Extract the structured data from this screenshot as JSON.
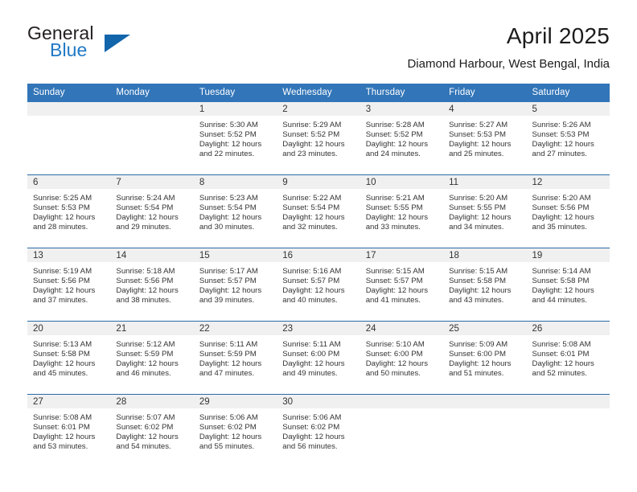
{
  "brand": {
    "name_top": "General",
    "name_bottom": "Blue",
    "triangle_color": "#1265ab",
    "text_color": "#231f20",
    "blue_color": "#2079c6"
  },
  "header": {
    "title": "April 2025",
    "subtitle": "Diamond Harbour, West Bengal, India"
  },
  "theme": {
    "header_row_bg": "#3275b8",
    "header_row_text": "#ffffff",
    "row_separator": "#2a6aa8",
    "daynum_band_bg": "#f0f0f0",
    "body_text": "#333333"
  },
  "weekdays": [
    "Sunday",
    "Monday",
    "Tuesday",
    "Wednesday",
    "Thursday",
    "Friday",
    "Saturday"
  ],
  "weeks": [
    [
      {
        "day": "",
        "lines": [
          "",
          "",
          "",
          ""
        ]
      },
      {
        "day": "",
        "lines": [
          "",
          "",
          "",
          ""
        ]
      },
      {
        "day": "1",
        "lines": [
          "Sunrise: 5:30 AM",
          "Sunset: 5:52 PM",
          "Daylight: 12 hours",
          "and 22 minutes."
        ]
      },
      {
        "day": "2",
        "lines": [
          "Sunrise: 5:29 AM",
          "Sunset: 5:52 PM",
          "Daylight: 12 hours",
          "and 23 minutes."
        ]
      },
      {
        "day": "3",
        "lines": [
          "Sunrise: 5:28 AM",
          "Sunset: 5:52 PM",
          "Daylight: 12 hours",
          "and 24 minutes."
        ]
      },
      {
        "day": "4",
        "lines": [
          "Sunrise: 5:27 AM",
          "Sunset: 5:53 PM",
          "Daylight: 12 hours",
          "and 25 minutes."
        ]
      },
      {
        "day": "5",
        "lines": [
          "Sunrise: 5:26 AM",
          "Sunset: 5:53 PM",
          "Daylight: 12 hours",
          "and 27 minutes."
        ]
      }
    ],
    [
      {
        "day": "6",
        "lines": [
          "Sunrise: 5:25 AM",
          "Sunset: 5:53 PM",
          "Daylight: 12 hours",
          "and 28 minutes."
        ]
      },
      {
        "day": "7",
        "lines": [
          "Sunrise: 5:24 AM",
          "Sunset: 5:54 PM",
          "Daylight: 12 hours",
          "and 29 minutes."
        ]
      },
      {
        "day": "8",
        "lines": [
          "Sunrise: 5:23 AM",
          "Sunset: 5:54 PM",
          "Daylight: 12 hours",
          "and 30 minutes."
        ]
      },
      {
        "day": "9",
        "lines": [
          "Sunrise: 5:22 AM",
          "Sunset: 5:54 PM",
          "Daylight: 12 hours",
          "and 32 minutes."
        ]
      },
      {
        "day": "10",
        "lines": [
          "Sunrise: 5:21 AM",
          "Sunset: 5:55 PM",
          "Daylight: 12 hours",
          "and 33 minutes."
        ]
      },
      {
        "day": "11",
        "lines": [
          "Sunrise: 5:20 AM",
          "Sunset: 5:55 PM",
          "Daylight: 12 hours",
          "and 34 minutes."
        ]
      },
      {
        "day": "12",
        "lines": [
          "Sunrise: 5:20 AM",
          "Sunset: 5:56 PM",
          "Daylight: 12 hours",
          "and 35 minutes."
        ]
      }
    ],
    [
      {
        "day": "13",
        "lines": [
          "Sunrise: 5:19 AM",
          "Sunset: 5:56 PM",
          "Daylight: 12 hours",
          "and 37 minutes."
        ]
      },
      {
        "day": "14",
        "lines": [
          "Sunrise: 5:18 AM",
          "Sunset: 5:56 PM",
          "Daylight: 12 hours",
          "and 38 minutes."
        ]
      },
      {
        "day": "15",
        "lines": [
          "Sunrise: 5:17 AM",
          "Sunset: 5:57 PM",
          "Daylight: 12 hours",
          "and 39 minutes."
        ]
      },
      {
        "day": "16",
        "lines": [
          "Sunrise: 5:16 AM",
          "Sunset: 5:57 PM",
          "Daylight: 12 hours",
          "and 40 minutes."
        ]
      },
      {
        "day": "17",
        "lines": [
          "Sunrise: 5:15 AM",
          "Sunset: 5:57 PM",
          "Daylight: 12 hours",
          "and 41 minutes."
        ]
      },
      {
        "day": "18",
        "lines": [
          "Sunrise: 5:15 AM",
          "Sunset: 5:58 PM",
          "Daylight: 12 hours",
          "and 43 minutes."
        ]
      },
      {
        "day": "19",
        "lines": [
          "Sunrise: 5:14 AM",
          "Sunset: 5:58 PM",
          "Daylight: 12 hours",
          "and 44 minutes."
        ]
      }
    ],
    [
      {
        "day": "20",
        "lines": [
          "Sunrise: 5:13 AM",
          "Sunset: 5:58 PM",
          "Daylight: 12 hours",
          "and 45 minutes."
        ]
      },
      {
        "day": "21",
        "lines": [
          "Sunrise: 5:12 AM",
          "Sunset: 5:59 PM",
          "Daylight: 12 hours",
          "and 46 minutes."
        ]
      },
      {
        "day": "22",
        "lines": [
          "Sunrise: 5:11 AM",
          "Sunset: 5:59 PM",
          "Daylight: 12 hours",
          "and 47 minutes."
        ]
      },
      {
        "day": "23",
        "lines": [
          "Sunrise: 5:11 AM",
          "Sunset: 6:00 PM",
          "Daylight: 12 hours",
          "and 49 minutes."
        ]
      },
      {
        "day": "24",
        "lines": [
          "Sunrise: 5:10 AM",
          "Sunset: 6:00 PM",
          "Daylight: 12 hours",
          "and 50 minutes."
        ]
      },
      {
        "day": "25",
        "lines": [
          "Sunrise: 5:09 AM",
          "Sunset: 6:00 PM",
          "Daylight: 12 hours",
          "and 51 minutes."
        ]
      },
      {
        "day": "26",
        "lines": [
          "Sunrise: 5:08 AM",
          "Sunset: 6:01 PM",
          "Daylight: 12 hours",
          "and 52 minutes."
        ]
      }
    ],
    [
      {
        "day": "27",
        "lines": [
          "Sunrise: 5:08 AM",
          "Sunset: 6:01 PM",
          "Daylight: 12 hours",
          "and 53 minutes."
        ]
      },
      {
        "day": "28",
        "lines": [
          "Sunrise: 5:07 AM",
          "Sunset: 6:02 PM",
          "Daylight: 12 hours",
          "and 54 minutes."
        ]
      },
      {
        "day": "29",
        "lines": [
          "Sunrise: 5:06 AM",
          "Sunset: 6:02 PM",
          "Daylight: 12 hours",
          "and 55 minutes."
        ]
      },
      {
        "day": "30",
        "lines": [
          "Sunrise: 5:06 AM",
          "Sunset: 6:02 PM",
          "Daylight: 12 hours",
          "and 56 minutes."
        ]
      },
      {
        "day": "",
        "lines": [
          "",
          "",
          "",
          ""
        ]
      },
      {
        "day": "",
        "lines": [
          "",
          "",
          "",
          ""
        ]
      },
      {
        "day": "",
        "lines": [
          "",
          "",
          "",
          ""
        ]
      }
    ]
  ]
}
